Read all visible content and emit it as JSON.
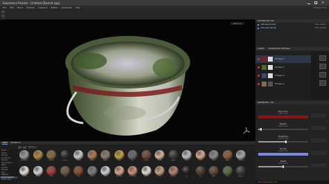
{
  "window": {
    "title": "Substance Painter - Untitled (Bucket.spp)"
  },
  "menu": {
    "items": [
      "File",
      "Edit",
      "Mode",
      "Window",
      "Viewport",
      "Python",
      "JavaScript",
      "Help"
    ],
    "hint": "Viewport  All"
  },
  "viewport": {
    "mode_label": "Material"
  },
  "texture_set_list": {
    "title": "TEXTURE SET LIST",
    "sets": [
      {
        "name": "u1Bucket_Bucket",
        "shader": "Main shader"
      },
      {
        "name": "u1Handle_Handle",
        "shader": "Main shader"
      }
    ]
  },
  "layers": {
    "tabs": [
      "LAYERS",
      "TEXTURE SET SETTINGS"
    ],
    "items": [
      {
        "name": "Fill layer 4",
        "active": true
      },
      {
        "name": "Fill layer 3",
        "active": false
      },
      {
        "name": "Fill layer 2",
        "active": false
      },
      {
        "name": "Fill layer 1",
        "active": false
      }
    ]
  },
  "properties": {
    "title": "PROPERTIES - FILL",
    "channels": [
      {
        "title": "Base Color",
        "sub": "uniform color",
        "color": "#8f1616",
        "type": "swatch"
      },
      {
        "title": "Metallic",
        "sub": "uniform color",
        "value": 0.05,
        "type": "slider"
      },
      {
        "title": "Roughness",
        "sub": "uniform color",
        "value": 0.55,
        "type": "slider"
      },
      {
        "title": "Normal",
        "sub": "uniform color",
        "color": "#7f86e6",
        "type": "swatch"
      },
      {
        "title": "Height",
        "sub": "uniform color",
        "value": 0.5,
        "type": "slider"
      }
    ]
  },
  "shelf": {
    "tabs": [
      "SHELF",
      "MATERIALS"
    ],
    "search_placeholder": "Search...",
    "categories": [
      "Project",
      "Alphas",
      "Grunges",
      "Procedurals",
      "Textures",
      "Hard Surfaces",
      "Filters",
      "Brushes",
      "Particles",
      "Tools",
      "Materials",
      "Smart materials",
      "Smart masks"
    ],
    "active_category": "Smart materials",
    "materials": [
      {
        "name": "Aluminium",
        "color": "#9a9a9a"
      },
      {
        "name": "Brass",
        "color": "#b08b3c"
      },
      {
        "name": "Bronze",
        "color": "#8a6a3a"
      },
      {
        "name": "Carbon",
        "color": "#2a2a2a"
      },
      {
        "name": "Chrome",
        "color": "#c9c9c9"
      },
      {
        "name": "Copper",
        "color": "#b5764d"
      },
      {
        "name": "Fabric",
        "color": "#8f7c6e"
      },
      {
        "name": "Gold",
        "color": "#c69e3d"
      },
      {
        "name": "Iron",
        "color": "#6a6a6a"
      },
      {
        "name": "Leather",
        "color": "#6f4a35"
      },
      {
        "name": "Plastic",
        "color": "#d7b29a"
      },
      {
        "name": "Rubber",
        "color": "#383838"
      },
      {
        "name": "Silver",
        "color": "#bfbfbf"
      },
      {
        "name": "Skin",
        "color": "#d8a688"
      },
      {
        "name": "Steel",
        "color": "#8a8a8a"
      },
      {
        "name": "Wood",
        "color": "#8a5a3a"
      },
      {
        "name": "Concrete",
        "color": "#a8a8a8"
      },
      {
        "name": "Ceramic",
        "color": "#e4ddd5"
      },
      {
        "name": "Marble",
        "color": "#d2d2d2"
      },
      {
        "name": "Paint",
        "color": "#a73a3a"
      },
      {
        "name": "Mud",
        "color": "#6e5a44"
      },
      {
        "name": "Rust",
        "color": "#8b4a2a"
      },
      {
        "name": "Stone",
        "color": "#7d7d7d"
      },
      {
        "name": "Glass",
        "color": "#c8d2d8"
      },
      {
        "name": "Skin Face",
        "color": "#d9a58a"
      },
      {
        "name": "Skin Hand",
        "color": "#c98f74"
      },
      {
        "name": "Paper",
        "color": "#e6dccd"
      },
      {
        "name": "Clay",
        "color": "#c99c7e"
      },
      {
        "name": "Lacquer",
        "color": "#b9806a"
      },
      {
        "name": "Tar",
        "color": "#202020"
      },
      {
        "name": "Soil",
        "color": "#4b3a2a"
      },
      {
        "name": "Bark",
        "color": "#5e4636"
      },
      {
        "name": "Moss",
        "color": "#5a6a3a"
      },
      {
        "name": "Asphalt",
        "color": "#3a3a3a"
      }
    ]
  },
  "status": {
    "text": "Cache Disk Usage: 12%"
  }
}
